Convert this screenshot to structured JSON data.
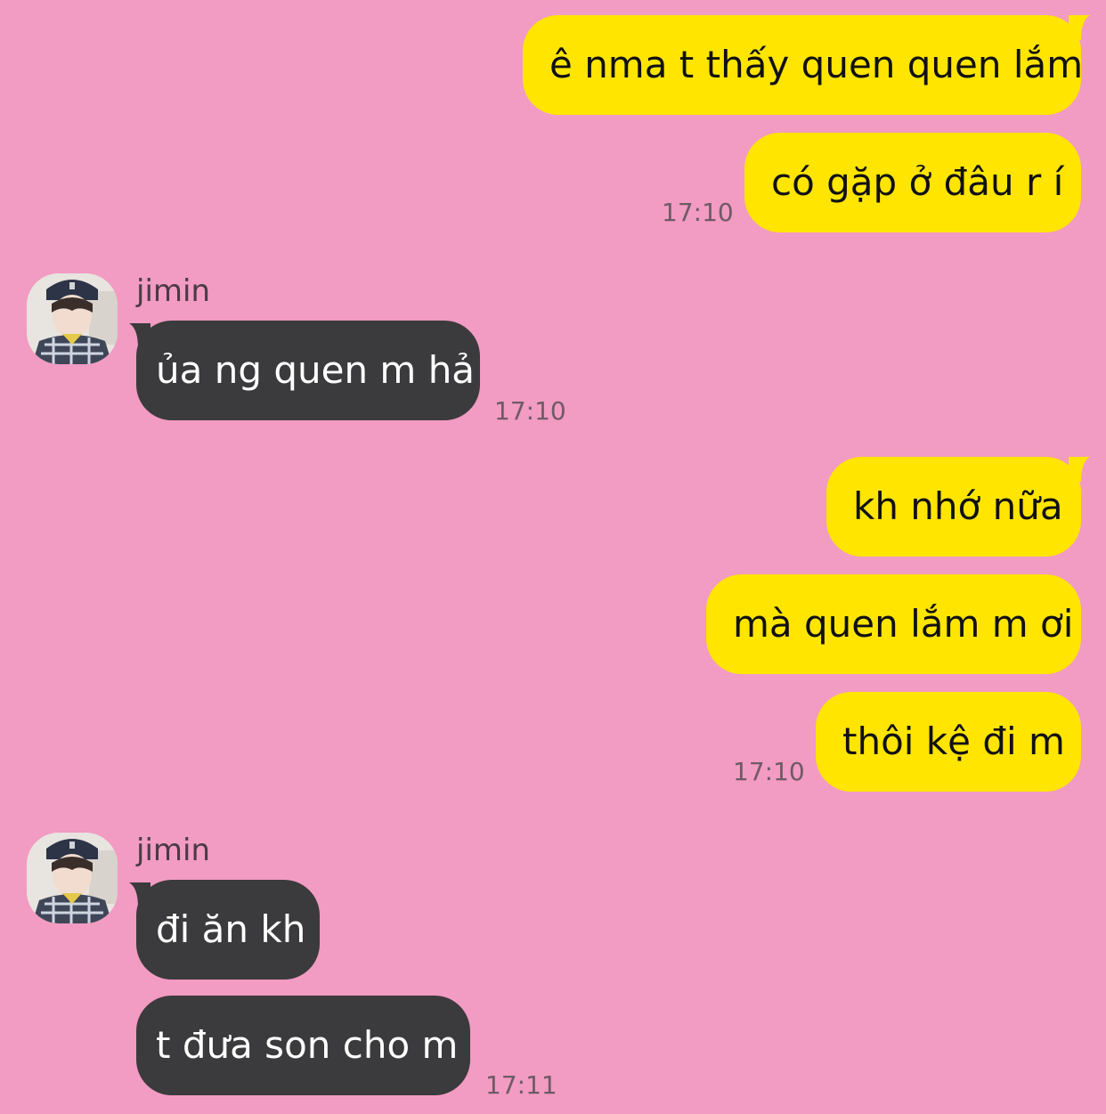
{
  "conversation": {
    "contact_name": "jimin",
    "messages": [
      {
        "from": "me",
        "text": "ê nma t thấy quen quen lắm"
      },
      {
        "from": "me",
        "text": "có gặp ở đâu r í",
        "time": "17:10"
      },
      {
        "from": "jimin",
        "text": "ủa ng quen m hả",
        "time": "17:10"
      },
      {
        "from": "me",
        "text": "kh nhớ nữa"
      },
      {
        "from": "me",
        "text": "mà quen lắm m ơi"
      },
      {
        "from": "me",
        "text": "thôi kệ đi m",
        "time": "17:10"
      },
      {
        "from": "jimin",
        "text": "đi ăn kh"
      },
      {
        "from": "jimin",
        "text": "t đưa son cho m",
        "time": "17:11"
      }
    ]
  },
  "colors": {
    "background": "#f29bc3",
    "outgoing_bubble": "#ffe500",
    "incoming_bubble": "#3b3a3c"
  },
  "icons": {
    "avatar": "profile-photo"
  }
}
